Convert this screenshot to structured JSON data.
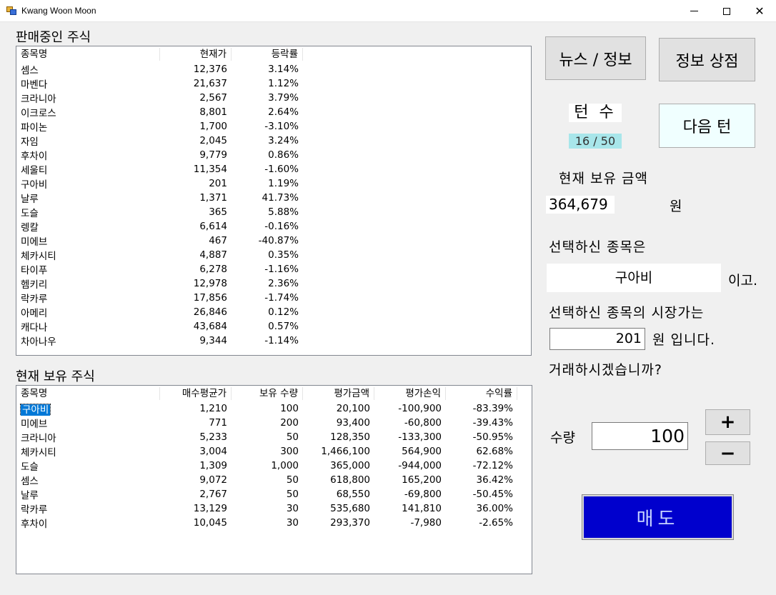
{
  "window": {
    "title": "Kwang Woon Moon"
  },
  "market": {
    "label": "판매중인 주식",
    "columns": [
      "종목명",
      "현재가",
      "등락률"
    ],
    "rows": [
      [
        "셈스",
        "12,376",
        "3.14%"
      ],
      [
        "마벤다",
        "21,637",
        "1.12%"
      ],
      [
        "크라니아",
        "2,567",
        "3.79%"
      ],
      [
        "이크로스",
        "8,801",
        "2.64%"
      ],
      [
        "파이논",
        "1,700",
        "-3.10%"
      ],
      [
        "자임",
        "2,045",
        "3.24%"
      ],
      [
        "후차이",
        "9,779",
        "0.86%"
      ],
      [
        "세울티",
        "11,354",
        "-1.60%"
      ],
      [
        "구아비",
        "201",
        "1.19%"
      ],
      [
        "날루",
        "1,371",
        "41.73%"
      ],
      [
        "도슬",
        "365",
        "5.88%"
      ],
      [
        "렝칼",
        "6,614",
        "-0.16%"
      ],
      [
        "미에브",
        "467",
        "-40.87%"
      ],
      [
        "체카시티",
        "4,887",
        "0.35%"
      ],
      [
        "타이푸",
        "6,278",
        "-1.16%"
      ],
      [
        "헴키리",
        "12,978",
        "2.36%"
      ],
      [
        "락카루",
        "17,856",
        "-1.74%"
      ],
      [
        "아메리",
        "26,846",
        "0.12%"
      ],
      [
        "캐다나",
        "43,684",
        "0.57%"
      ],
      [
        "차아나우",
        "9,344",
        "-1.14%"
      ]
    ]
  },
  "holdings": {
    "label": "현재 보유 주식",
    "columns": [
      "종목명",
      "매수평균가",
      "보유 수량",
      "평가금액",
      "평가손익",
      "수익률"
    ],
    "rows": [
      [
        "구아비",
        "1,210",
        "100",
        "20,100",
        "-100,900",
        "-83.39%"
      ],
      [
        "미에브",
        "771",
        "200",
        "93,400",
        "-60,800",
        "-39.43%"
      ],
      [
        "크라니아",
        "5,233",
        "50",
        "128,350",
        "-133,300",
        "-50.95%"
      ],
      [
        "체카시티",
        "3,004",
        "300",
        "1,466,100",
        "564,900",
        "62.68%"
      ],
      [
        "도슬",
        "1,309",
        "1,000",
        "365,000",
        "-944,000",
        "-72.12%"
      ],
      [
        "셈스",
        "9,072",
        "50",
        "618,800",
        "165,200",
        "36.42%"
      ],
      [
        "날루",
        "2,767",
        "50",
        "68,550",
        "-69,800",
        "-50.45%"
      ],
      [
        "락카루",
        "13,129",
        "30",
        "535,680",
        "141,810",
        "36.00%"
      ],
      [
        "후차이",
        "10,045",
        "30",
        "293,370",
        "-7,980",
        "-2.65%"
      ]
    ]
  },
  "buttons": {
    "news": "뉴스 / 정보",
    "shop": "정보 상점",
    "next_turn": "다음 턴",
    "plus": "+",
    "minus": "−",
    "sell": "매도"
  },
  "turn": {
    "label": "턴 수",
    "value": "16 / 50"
  },
  "money": {
    "label": "현재 보유 금액",
    "value": "364,679",
    "unit": "원"
  },
  "selection": {
    "label": "선택하신 종목은",
    "stock": "구아비",
    "suffix": "이고.",
    "price_label": "선택하신 종목의 시장가는",
    "price": "201",
    "price_suffix": "원 입니다.",
    "question": "거래하시겠습니까?"
  },
  "quantity": {
    "label": "수량",
    "value": "100"
  },
  "colors": {
    "turn_value_bg": "#a8e6ea",
    "next_turn_bg": "#f0ffff",
    "sell_bg": "#0000cd",
    "selection_highlight": "#0078d7"
  }
}
